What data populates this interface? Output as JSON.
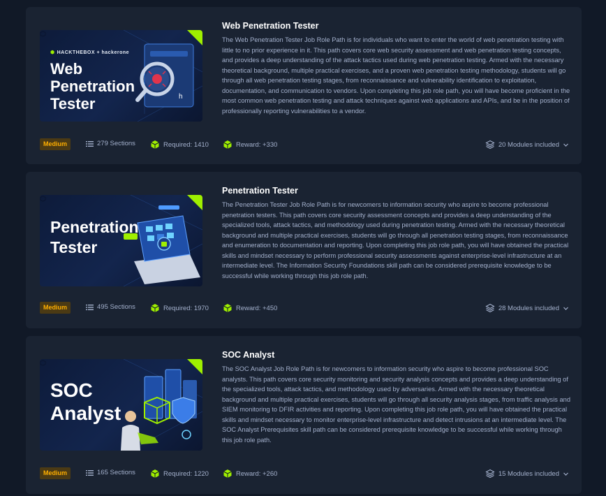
{
  "colors": {
    "page_bg": "#111927",
    "card_bg": "#1a2332",
    "accent_green": "#9fef00",
    "medium_badge": "#ffaf00"
  },
  "paths": [
    {
      "thumb_brand": "HACKTHEBOX + hackerone",
      "thumb_title": "Web\nPenetration\nTester",
      "title": "Web Penetration Tester",
      "description": "The Web Penetration Tester Job Role Path is for individuals who want to enter the world of web penetration testing with little to no prior experience in it. This path covers core web security assessment and web penetration testing concepts, and provides a deep understanding of the attack tactics used during web penetration testing. Armed with the necessary theoretical background, multiple practical exercises, and a proven web penetration testing methodology, students will go through all web penetration testing stages, from reconnaissance and vulnerability identification to exploitation, documentation, and communication to vendors. Upon completing this job role path, you will have become proficient in the most common web penetration testing and attack techniques against web applications and APIs, and be in the position of professionally reporting vulnerabilities to a vendor.",
      "difficulty": "Medium",
      "sections": "279 Sections",
      "required": "Required: 1410",
      "reward": "Reward: +330",
      "modules": "20 Modules included"
    },
    {
      "thumb_title": "Penetration\nTester",
      "title": "Penetration Tester",
      "description": "The Penetration Tester Job Role Path is for newcomers to information security who aspire to become professional penetration testers. This path covers core security assessment concepts and provides a deep understanding of the specialized tools, attack tactics, and methodology used during penetration testing. Armed with the necessary theoretical background and multiple practical exercises, students will go through all penetration testing stages, from reconnaissance and enumeration to documentation and reporting. Upon completing this job role path, you will have obtained the practical skills and mindset necessary to perform professional security assessments against enterprise-level infrastructure at an intermediate level. The Information Security Foundations skill path can be considered prerequisite knowledge to be successful while working through this job role path.",
      "difficulty": "Medium",
      "sections": "495 Sections",
      "required": "Required: 1970",
      "reward": "Reward: +450",
      "modules": "28 Modules included"
    },
    {
      "thumb_title": "SOC\nAnalyst",
      "title": "SOC Analyst",
      "description": "The SOC Analyst Job Role Path is for newcomers to information security who aspire to become professional SOC analysts. This path covers core security monitoring and security analysis concepts and provides a deep understanding of the specialized tools, attack tactics, and methodology used by adversaries. Armed with the necessary theoretical background and multiple practical exercises, students will go through all security analysis stages, from traffic analysis and SIEM monitoring to DFIR activities and reporting. Upon completing this job role path, you will have obtained the practical skills and mindset necessary to monitor enterprise-level infrastructure and detect intrusions at an intermediate level. The SOC Analyst Prerequisites skill path can be considered prerequisite knowledge to be successful while working through this job role path.",
      "difficulty": "Medium",
      "sections": "165 Sections",
      "required": "Required: 1220",
      "reward": "Reward: +260",
      "modules": "15 Modules included"
    }
  ]
}
